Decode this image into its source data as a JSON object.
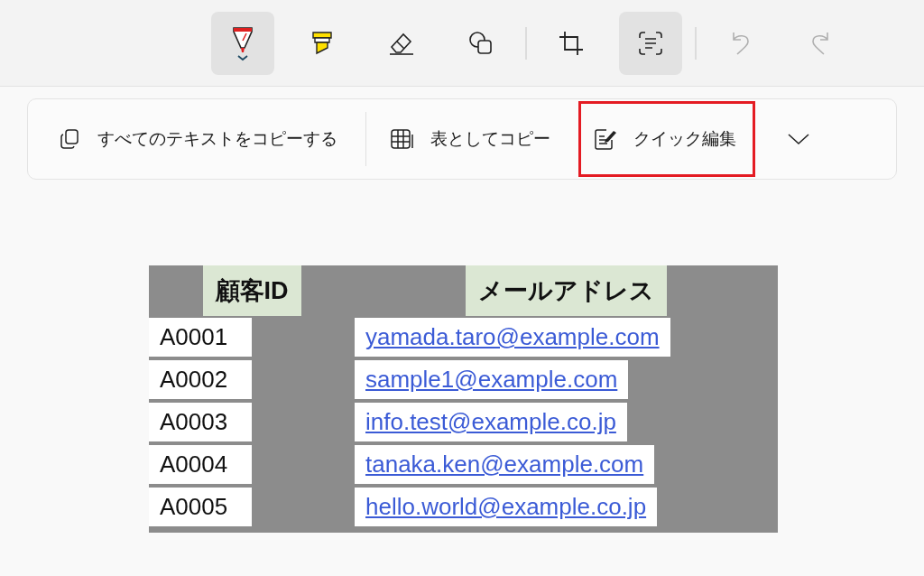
{
  "toolbar": {
    "groups": [
      [
        {
          "kind": "pen",
          "selected": true,
          "disabled": false
        },
        {
          "kind": "highlighter",
          "selected": false,
          "disabled": false
        },
        {
          "kind": "eraser",
          "selected": false,
          "disabled": false
        },
        {
          "kind": "shapes",
          "selected": false,
          "disabled": false
        }
      ],
      [
        {
          "kind": "crop",
          "selected": false,
          "disabled": false
        },
        {
          "kind": "text-actions",
          "selected": true,
          "disabled": false
        }
      ],
      [
        {
          "kind": "undo",
          "selected": false,
          "disabled": true
        },
        {
          "kind": "redo",
          "selected": false,
          "disabled": true
        }
      ]
    ]
  },
  "text_actions": {
    "actions": [
      {
        "kind": "copy-all",
        "label": "すべてのテキストをコピーする",
        "highlighted": false
      },
      {
        "kind": "copy-table",
        "label": "表としてコピー",
        "highlighted": false
      },
      {
        "kind": "quick-edit",
        "label": "クイック編集",
        "highlighted": true
      }
    ]
  },
  "capture": {
    "columns": [
      "顧客ID",
      "メールアドレス"
    ],
    "rows": [
      {
        "id": "A0001",
        "email": "yamada.taro@example.com"
      },
      {
        "id": "A0002",
        "email": "sample1@example.com"
      },
      {
        "id": "A0003",
        "email": "info.test@example.co.jp"
      },
      {
        "id": "A0004",
        "email": "tanaka.ken@example.com"
      },
      {
        "id": "A0005",
        "email": "hello.world@example.co.jp"
      }
    ]
  }
}
